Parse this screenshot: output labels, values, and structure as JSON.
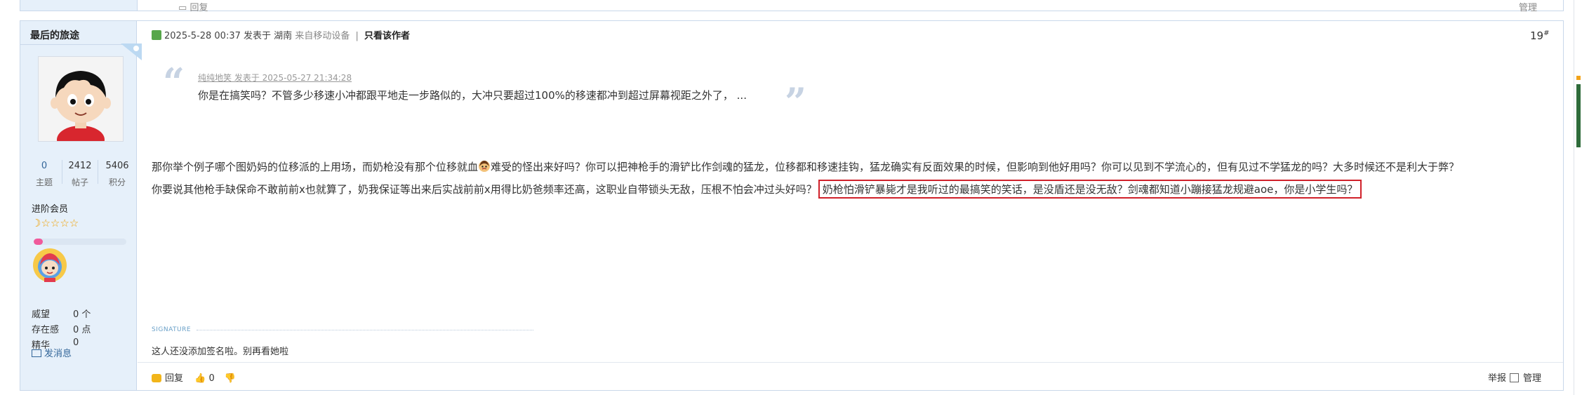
{
  "prev_post": {
    "reply_label": "回复",
    "manage_label": "管理"
  },
  "author": {
    "name": "最后的旅途",
    "stats": [
      {
        "value": "0",
        "label": "主题"
      },
      {
        "value": "2412",
        "label": "帖子"
      },
      {
        "value": "5406",
        "label": "积分"
      }
    ],
    "rank": "进阶会员",
    "stars_text": "☽☆☆☆☆",
    "progress": 0.1,
    "info": [
      {
        "key": "威望",
        "value": "0 个"
      },
      {
        "key": "存在感",
        "value": "0 点"
      },
      {
        "key": "精华",
        "value": "0"
      }
    ],
    "pm_label": "发消息"
  },
  "post": {
    "meta_date": "2025-5-28 00:37",
    "meta_posted": "发表于",
    "meta_location": "湖南",
    "meta_device": "来自移动设备",
    "meta_sep": "|",
    "meta_only_author": "只看该作者",
    "floor": "19",
    "floor_sup": "#",
    "quote_source": "纯纯地笑 发表于 2025-05-27 21:34:28",
    "quote_text": "你是在搞笑吗？不管多少移速小冲都跟平地走一步路似的，大冲只要超过100%的移速都冲到超过屏幕视距之外了，  ...",
    "line1_a": "那你举个例子哪个图奶妈的位移派的上用场，而奶枪没有那个位移就血",
    "line1_b": "难受的怪出来好吗？你可以把神枪手的滑铲比作剑魂的猛龙，位移都和移速挂钩，猛龙确实有反面效果的时候，但影响到他好用吗？你可以见到不学流心的，但有见过不学猛龙的吗？大多时候还不是利大于弊？",
    "line2_a": "你要说其他枪手缺保命不敢前前x也就算了，奶我保证等出来后实战前前x用得比奶爸频率还高，这职业自带锁头无敌，压根不怕会冲过头好吗？",
    "line2_highlight": "奶枪怕滑铲暴毙才是我听过的最搞笑的笑话，是没盾还是没无敌？剑魂都知道小蹦接猛龙规避aoe，你是小学生吗？",
    "signature_label": "SIGNATURE",
    "signature_text": "这人还没添加签名啦。别再看她啦",
    "reply_label": "回复",
    "like_count": "0",
    "report_label": "举报",
    "manage_label": "管理"
  },
  "colors": {
    "author_bg": "#e6f0fa",
    "border": "#c9d8ea",
    "highlight_box": "#d0212a",
    "link": "#336699"
  }
}
